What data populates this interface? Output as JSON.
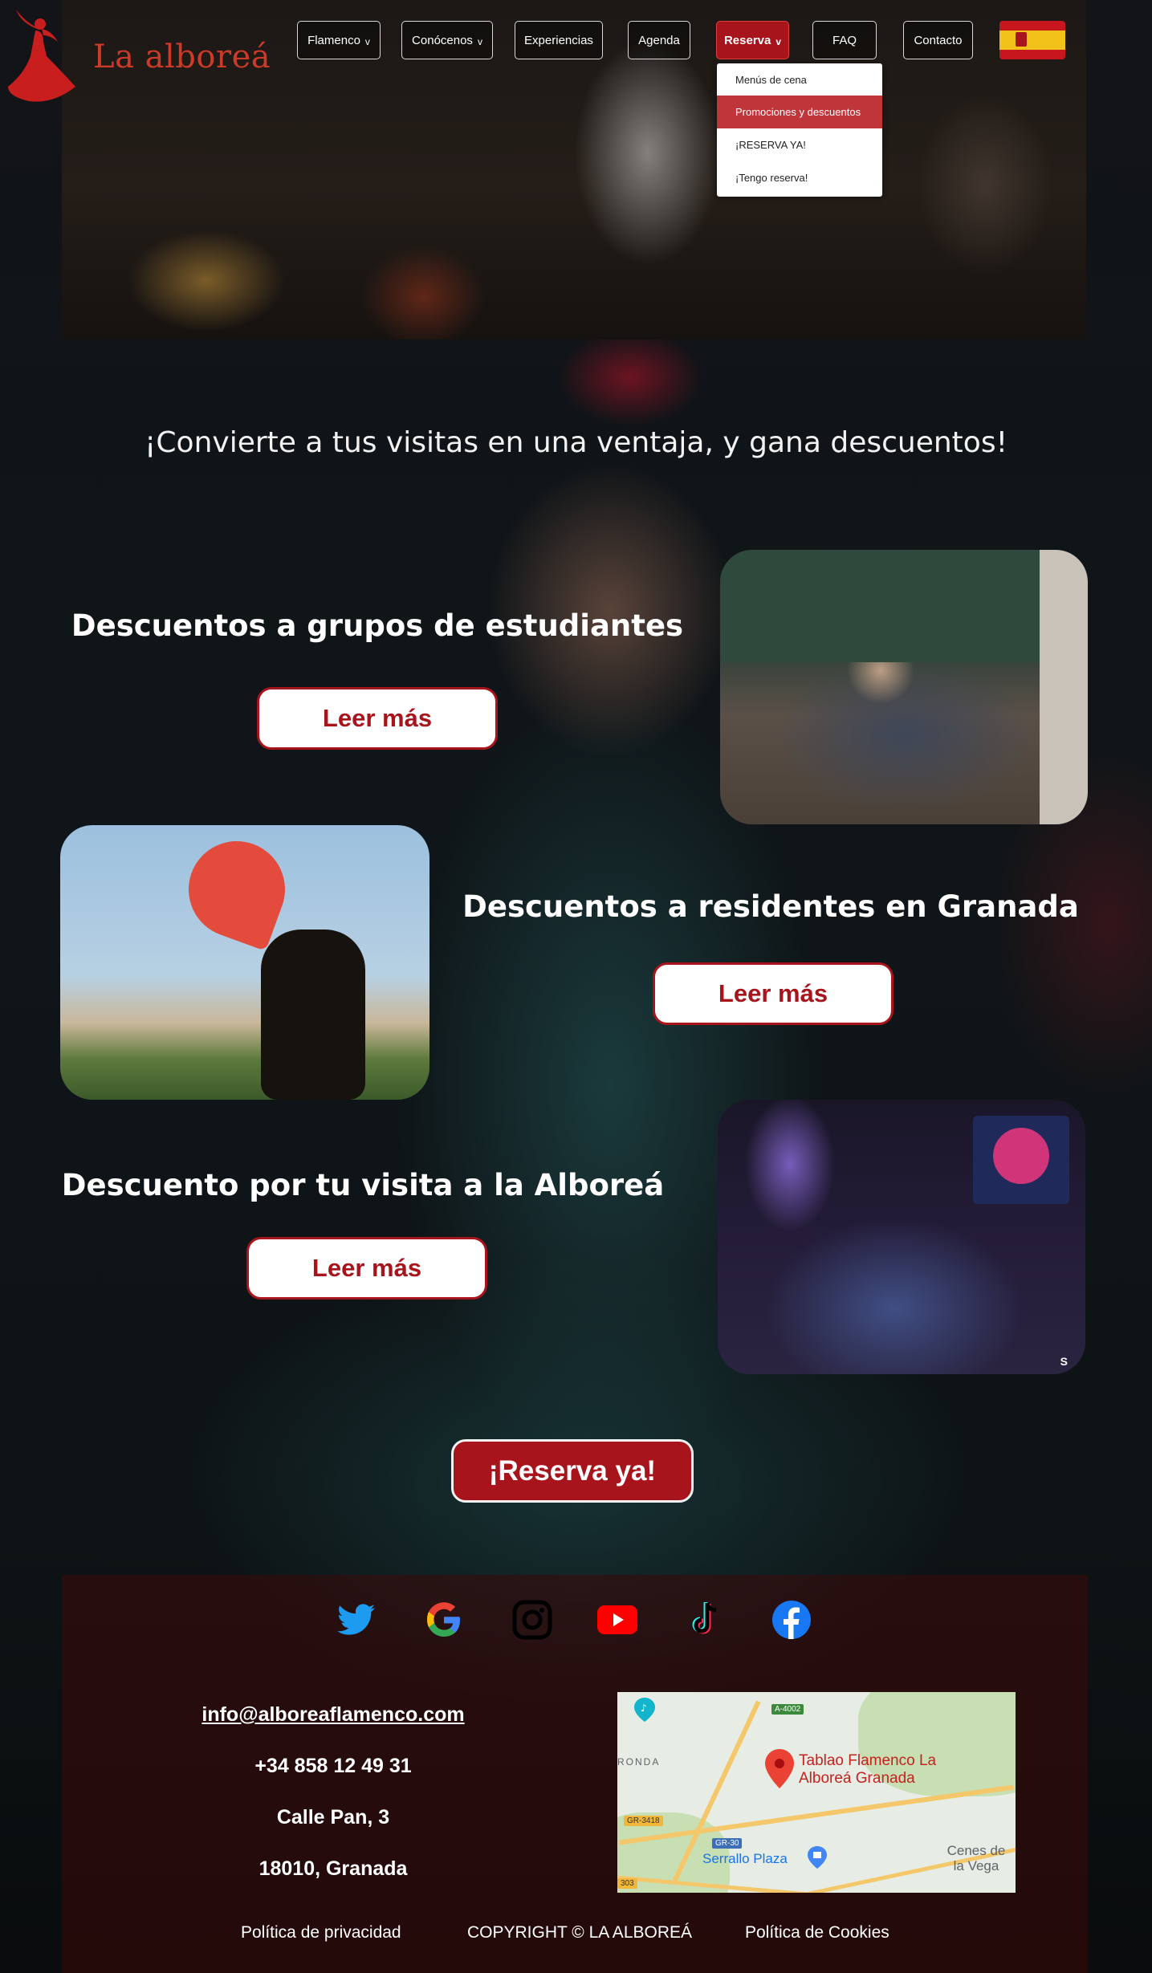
{
  "brand": {
    "name": "La alboreá"
  },
  "nav": {
    "items": [
      {
        "label": "Flamenco",
        "has_dropdown": true
      },
      {
        "label": "Conócenos",
        "has_dropdown": true
      },
      {
        "label": "Experiencias",
        "has_dropdown": false
      },
      {
        "label": "Agenda",
        "has_dropdown": false
      },
      {
        "label": "Reserva",
        "has_dropdown": true,
        "active": true
      },
      {
        "label": "FAQ",
        "has_dropdown": false
      },
      {
        "label": "Contacto",
        "has_dropdown": false
      }
    ],
    "language_flag": "spanish-flag-icon",
    "dropdown": {
      "items": [
        {
          "label": "Menús de cena",
          "highlighted": false
        },
        {
          "label": "Promociones y descuentos",
          "highlighted": true
        },
        {
          "label": "¡RESERVA YA!",
          "highlighted": false
        },
        {
          "label": "¡Tengo reserva!",
          "highlighted": false
        }
      ]
    }
  },
  "main": {
    "headline": "¡Convierte a tus visitas en una ventaja, y gana descuentos!",
    "promos": [
      {
        "title": "Descuentos a grupos de estudiantes",
        "button": "Leer más"
      },
      {
        "title": "Descuentos a residentes en Granada",
        "button": "Leer más"
      },
      {
        "title": "Descuento por tu visita a la Alboreá",
        "button": "Leer más"
      }
    ],
    "cta": "¡Reserva ya!"
  },
  "footer": {
    "social": [
      "twitter-icon",
      "google-icon",
      "instagram-icon",
      "youtube-icon",
      "tiktok-icon",
      "facebook-icon"
    ],
    "email": "info@alboreaflamenco.com",
    "phone": "+34 858 12 49 31",
    "street": "Calle Pan, 3",
    "city": "18010, Granada",
    "map": {
      "place": "Tablao Flamenco La Alboreá Granada",
      "labels": [
        "A-4002",
        "RONDA",
        "GR-3418",
        "GR-30",
        "Serrallo Plaza",
        "Cenes de la Vega",
        "303"
      ]
    },
    "links": {
      "privacy": "Política de privacidad",
      "copyright": "COPYRIGHT © LA ALBOREÁ",
      "cookies": "Política de Cookies"
    }
  },
  "colors": {
    "brand_red": "#a8141c",
    "logo_red": "#cc3a2a",
    "dropdown_highlight": "#c0353a"
  }
}
